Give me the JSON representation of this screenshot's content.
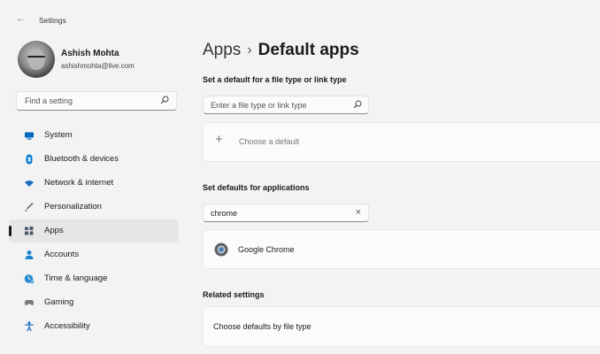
{
  "window": {
    "title": "Settings",
    "back_icon": "back-arrow-icon"
  },
  "profile": {
    "name": "Ashish Mohta",
    "email": "ashishmohta@live.com"
  },
  "sidebar": {
    "search_placeholder": "Find a setting",
    "items": [
      {
        "label": "System",
        "icon": "monitor-icon",
        "color": "#0067c0"
      },
      {
        "label": "Bluetooth & devices",
        "icon": "bluetooth-icon",
        "color": "#0078d4"
      },
      {
        "label": "Network & internet",
        "icon": "wifi-icon",
        "color": "#1f6fbf"
      },
      {
        "label": "Personalization",
        "icon": "brush-icon",
        "color": "#707070"
      },
      {
        "label": "Apps",
        "icon": "apps-icon",
        "color": "#4a5a6a",
        "selected": true
      },
      {
        "label": "Accounts",
        "icon": "person-icon",
        "color": "#1a86d0"
      },
      {
        "label": "Time & language",
        "icon": "globe-clock-icon",
        "color": "#2a8ad0"
      },
      {
        "label": "Gaming",
        "icon": "gamepad-icon",
        "color": "#7a7a7a"
      },
      {
        "label": "Accessibility",
        "icon": "accessibility-icon",
        "color": "#1a6fc0"
      }
    ]
  },
  "main": {
    "breadcrumb_parent": "Apps",
    "breadcrumb_sep": "›",
    "breadcrumb_current": "Default apps",
    "filetype_section_label": "Set a default for a file type or link type",
    "filetype_input_placeholder": "Enter a file type or link type",
    "choose_default_label": "Choose a default",
    "apps_section_label": "Set defaults for applications",
    "app_search_value": "chrome",
    "app_result_label": "Google Chrome",
    "related_section_label": "Related settings",
    "related_item_label": "Choose defaults by file type"
  },
  "colors": {
    "background": "#f3f3f3",
    "card": "#fbfbfb",
    "selected_item": "#e6e6e6"
  }
}
